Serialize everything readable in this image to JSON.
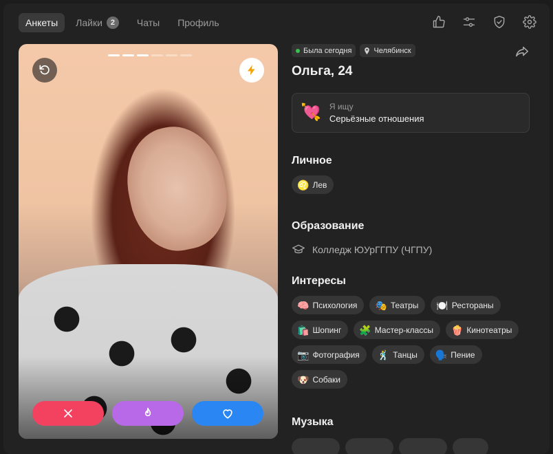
{
  "nav": {
    "tabs": [
      {
        "label": "Анкеты",
        "active": true
      },
      {
        "label": "Лайки",
        "badge": "2"
      },
      {
        "label": "Чаты"
      },
      {
        "label": "Профиль"
      }
    ],
    "icons": [
      "thumbs-up-icon",
      "sliders-icon",
      "shield-check-icon",
      "gear-icon"
    ]
  },
  "card": {
    "photo_count": 6,
    "active_photo_index": 1,
    "buttons": [
      "dislike",
      "super-like",
      "like"
    ]
  },
  "profile": {
    "last_seen": "Была сегодня",
    "city": "Челябинск",
    "name_age": "Ольга, 24",
    "looking": {
      "label": "Я ищу",
      "value": "Серьёзные отношения",
      "emoji": "💘"
    },
    "personal_title": "Личное",
    "personal": [
      {
        "emoji": "♌",
        "label": "Лев"
      }
    ],
    "education_title": "Образование",
    "education": "Колледж ЮУрГГПУ (ЧГПУ)",
    "interests_title": "Интересы",
    "interests": [
      {
        "emoji": "🧠",
        "label": "Психология"
      },
      {
        "emoji": "🎭",
        "label": "Театры"
      },
      {
        "emoji": "🍽️",
        "label": "Рестораны"
      },
      {
        "emoji": "🛍️",
        "label": "Шопинг"
      },
      {
        "emoji": "🧩",
        "label": "Мастер-классы"
      },
      {
        "emoji": "🍿",
        "label": "Кинотеатры"
      },
      {
        "emoji": "📷",
        "label": "Фотография"
      },
      {
        "emoji": "🕺",
        "label": "Танцы"
      },
      {
        "emoji": "🗣️",
        "label": "Пение"
      },
      {
        "emoji": "🐶",
        "label": "Собаки"
      }
    ],
    "music_title": "Музыка"
  },
  "colors": {
    "dislike": "#f2425f",
    "super": "#b869e8",
    "like": "#2a86f2",
    "online": "#37c24f"
  }
}
